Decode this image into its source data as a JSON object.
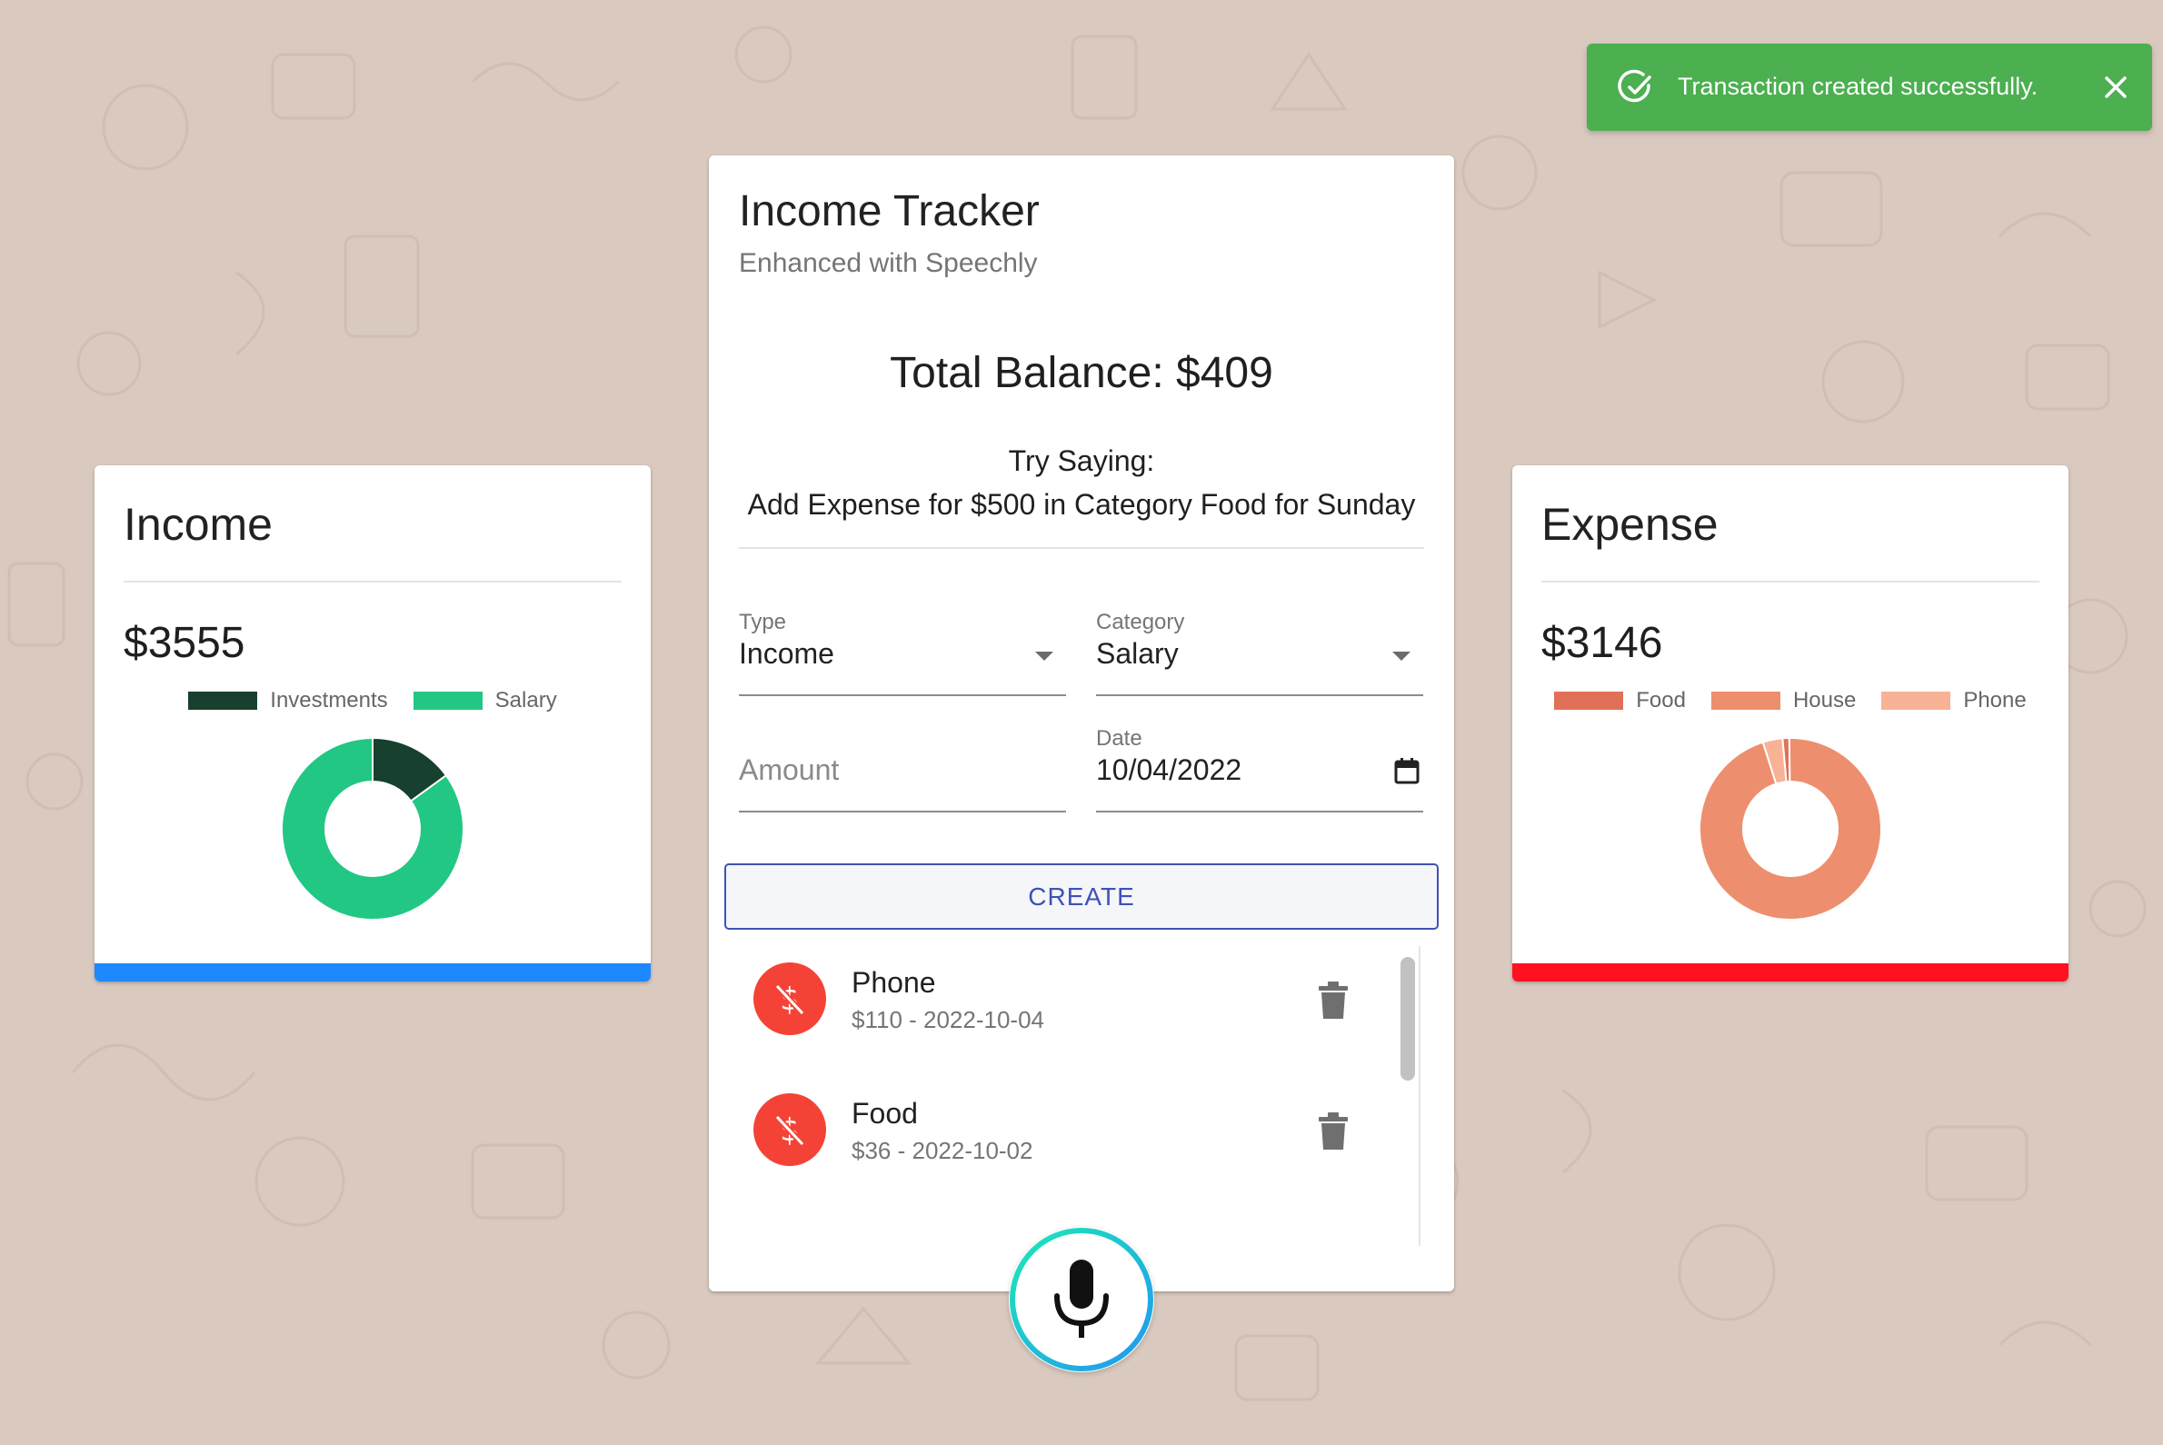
{
  "income": {
    "title": "Income",
    "amount": "$3555",
    "bar_color": "#1e88ff",
    "legend": [
      {
        "label": "Investments",
        "color": "#17402e"
      },
      {
        "label": "Salary",
        "color": "#22c784"
      }
    ],
    "slices": [
      {
        "label": "Investments",
        "share": 0.15,
        "color": "#17402e"
      },
      {
        "label": "Salary",
        "share": 0.85,
        "color": "#22c784"
      }
    ]
  },
  "expense": {
    "title": "Expense",
    "amount": "$3146",
    "bar_color": "#ff1121",
    "legend": [
      {
        "label": "Food",
        "color": "#e07158"
      },
      {
        "label": "House",
        "color": "#ed8f6e"
      },
      {
        "label": "Phone",
        "color": "#f8b295"
      }
    ],
    "slices": [
      {
        "label": "Food",
        "share": 0.012,
        "color": "#e07158"
      },
      {
        "label": "House",
        "share": 0.953,
        "color": "#ed8f6e"
      },
      {
        "label": "Phone",
        "share": 0.035,
        "color": "#f8b295"
      }
    ]
  },
  "main": {
    "title": "Income Tracker",
    "subtitle": "Enhanced with Speechly",
    "balance": "Total Balance: $409",
    "try_line1": "Try Saying:",
    "try_line2": "Add Expense for $500 in Category Food for Sunday",
    "form": {
      "type_label": "Type",
      "type_value": "Income",
      "category_label": "Category",
      "category_value": "Salary",
      "amount_placeholder": "Amount",
      "date_label": "Date",
      "date_value": "10/04/2022",
      "create_label": "CREATE"
    },
    "transactions": [
      {
        "name": "Phone",
        "detail": "$110 - 2022-10-04",
        "type": "expense"
      },
      {
        "name": "Food",
        "detail": "$36 - 2022-10-02",
        "type": "expense"
      }
    ]
  },
  "toast": {
    "message": "Transaction created successfully.",
    "color": "#4caf50"
  },
  "icons": {
    "toast": "check-circle-icon",
    "close": "close-icon",
    "dropdown": "chevron-down-icon",
    "calendar": "calendar-icon",
    "transaction": "money-off-icon",
    "delete": "trash-icon",
    "mic": "microphone-icon"
  }
}
